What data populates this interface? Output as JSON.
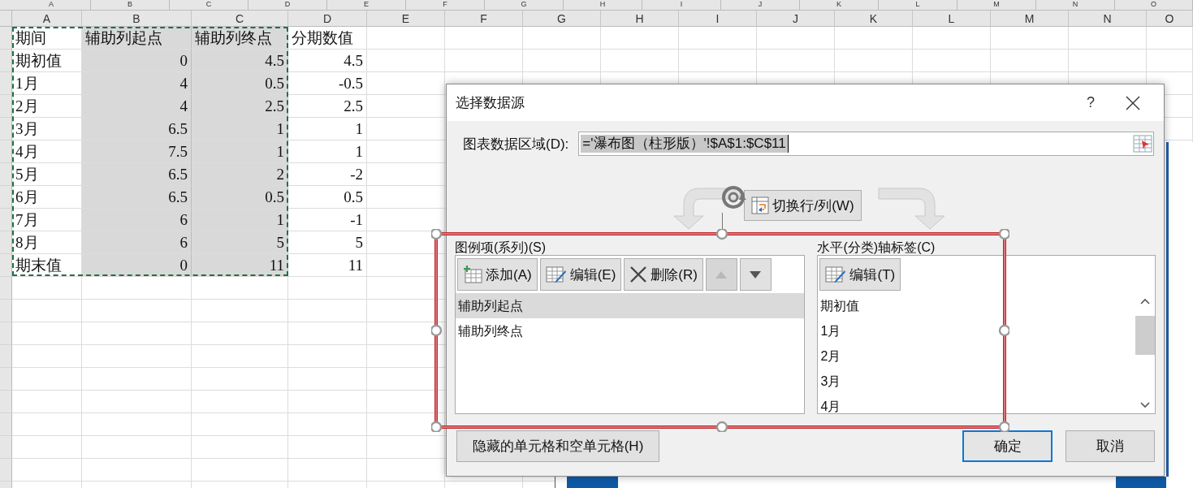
{
  "sheet": {
    "header_top": [
      "A",
      "B",
      "C",
      "D",
      "E",
      "F",
      "G",
      "H",
      "I",
      "J",
      "K",
      "L",
      "M",
      "N",
      "O"
    ],
    "header": [
      "A",
      "B",
      "C",
      "D",
      "E",
      "F",
      "G",
      "H",
      "I",
      "J",
      "K",
      "L",
      "M",
      "N",
      "O"
    ],
    "data_columns": [
      {
        "shaded": false
      },
      {
        "shaded": true
      },
      {
        "shaded": true
      },
      {
        "shaded": false
      }
    ],
    "rows": [
      {
        "cells": [
          "期间",
          "辅助列起点",
          "辅助列终点",
          "分期数值"
        ]
      },
      {
        "cells": [
          "期初值",
          "0",
          "4.5",
          "4.5"
        ]
      },
      {
        "cells": [
          "1月",
          "4",
          "0.5",
          "-0.5"
        ]
      },
      {
        "cells": [
          "2月",
          "4",
          "2.5",
          "2.5"
        ]
      },
      {
        "cells": [
          "3月",
          "6.5",
          "1",
          "1"
        ]
      },
      {
        "cells": [
          "4月",
          "7.5",
          "1",
          "1"
        ]
      },
      {
        "cells": [
          "5月",
          "6.5",
          "2",
          "-2"
        ]
      },
      {
        "cells": [
          "6月",
          "6.5",
          "0.5",
          "0.5"
        ]
      },
      {
        "cells": [
          "7月",
          "6",
          "1",
          "-1"
        ]
      },
      {
        "cells": [
          "8月",
          "6",
          "5",
          "5"
        ]
      },
      {
        "cells": [
          "期末值",
          "0",
          "11",
          "11"
        ]
      }
    ]
  },
  "dialog": {
    "title": "选择数据源",
    "help": "?",
    "range_label": "图表数据区域(D):",
    "range_value": "='瀑布图（柱形版）'!$A$1:$C$11",
    "switch_button": "切换行/列(W)",
    "series_panel": {
      "label": "图例项(系列)(S)",
      "buttons": [
        {
          "kind": "add",
          "label": "添加(A)",
          "disabled": false
        },
        {
          "kind": "edit",
          "label": "编辑(E)",
          "disabled": false
        },
        {
          "kind": "remove",
          "label": "删除(R)",
          "disabled": false
        },
        {
          "kind": "up",
          "disabled": true
        },
        {
          "kind": "down",
          "disabled": false
        }
      ],
      "items": [
        {
          "label": "辅助列起点",
          "selected": true
        },
        {
          "label": "辅助列终点",
          "selected": false
        }
      ]
    },
    "axis_panel": {
      "label": "水平(分类)轴标签(C)",
      "buttons": [
        {
          "kind": "edit",
          "label": "编辑(T)",
          "disabled": false
        }
      ],
      "items": [
        {
          "label": "期初值"
        },
        {
          "label": "1月"
        },
        {
          "label": "2月"
        },
        {
          "label": "3月"
        },
        {
          "label": "4月"
        }
      ]
    },
    "hidden_cells_button": "隐藏的单元格和空单元格(H)",
    "ok_button": "确定",
    "cancel_button": "取消"
  }
}
